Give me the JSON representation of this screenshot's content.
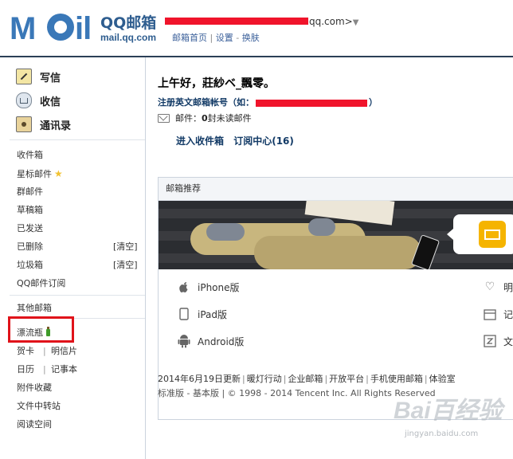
{
  "header": {
    "logo_text": "MOil",
    "logo_cn": "QQ邮箱",
    "logo_url": "mail.qq.com",
    "account_suffix": "qq.com>",
    "account_arrow": "▼",
    "links": [
      "邮箱首页",
      "设置",
      "换肤"
    ]
  },
  "sidebar": {
    "primary": [
      {
        "label": "写信",
        "icon": "compose-icon"
      },
      {
        "label": "收信",
        "icon": "inbox-icon"
      },
      {
        "label": "通讯录",
        "icon": "contacts-icon"
      }
    ],
    "folders": [
      "收件箱",
      "星标邮件",
      "群邮件",
      "草稿箱",
      "已发送",
      "已删除",
      "垃圾箱",
      "QQ邮件订阅"
    ],
    "clear_label": "[清空]",
    "other": [
      "其他邮箱",
      "漂流瓶",
      "贺卡",
      "明信片",
      "日历",
      "记事本",
      "附件收藏",
      "文件中转站",
      "阅读空间"
    ]
  },
  "main": {
    "greeting": "上午好，莊紗ベ_飄零。",
    "register_prefix": "注册英文邮箱帐号（如：",
    "register_suffix": "）",
    "mail_label": "邮件：",
    "mail_count": "0",
    "mail_unread": " 封未读邮件",
    "links": [
      "进入收件箱",
      "订阅中心(16)"
    ],
    "panel_title": "邮箱推荐",
    "clients_left": [
      {
        "label": "iPhone版",
        "icon": "apple-icon"
      },
      {
        "label": "iPad版",
        "icon": "tablet-icon"
      },
      {
        "label": "Android版",
        "icon": "android-icon"
      }
    ],
    "clients_right": [
      {
        "label": "明",
        "icon": "heart-icon"
      },
      {
        "label": "记",
        "icon": "calendar-icon"
      },
      {
        "label": "文",
        "icon": "transfer-icon"
      }
    ],
    "footer_links": [
      "2014年6月19日更新",
      "暖灯行动",
      "企业邮箱",
      "开放平台",
      "手机使用邮箱",
      "体验室"
    ],
    "footer2": "标准版 - 基本版 | © 1998 - 2014 Tencent Inc. All Rights Reserved"
  },
  "watermark": {
    "line1": "Bai百经验",
    "line2": "jingyan.baidu.com"
  },
  "colors": {
    "brand": "#3a78b8",
    "highlight": "#e0131a",
    "link": "#123a66"
  }
}
